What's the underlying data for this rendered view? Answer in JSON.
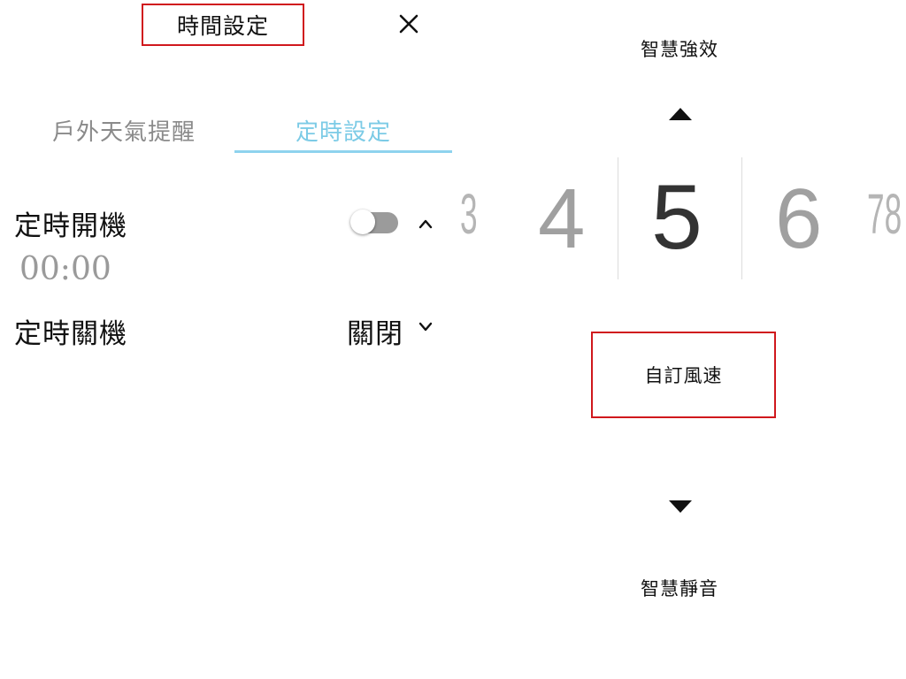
{
  "header": {
    "title": "時間設定",
    "close_icon": "close-icon"
  },
  "tabs": [
    {
      "label": "戶外天氣提醒",
      "active": false
    },
    {
      "label": "定時設定",
      "active": true
    }
  ],
  "accent_color": "#7ccbe6",
  "highlight_color": "#d0181d",
  "timer": {
    "power_on_label": "定時開機",
    "power_on_time": "00:00",
    "power_on_enabled": false,
    "power_off_label": "定時關機",
    "power_off_value": "關閉"
  },
  "fan": {
    "mode_above": "智慧強效",
    "mode_current": "自訂風速",
    "mode_below": "智慧靜音",
    "speed_picker": {
      "selected": "5",
      "items": [
        "3",
        "4",
        "5",
        "6",
        "78"
      ]
    },
    "up_icon": "triangle-up-icon",
    "down_icon": "triangle-down-icon"
  }
}
